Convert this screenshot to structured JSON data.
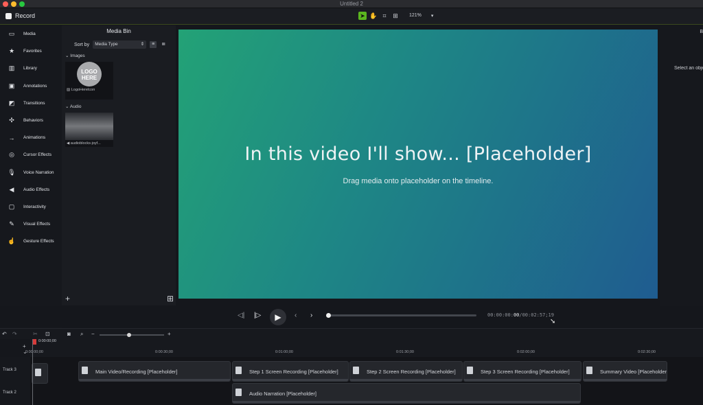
{
  "window": {
    "title": "Untitled 2",
    "record_label": "Record"
  },
  "toolbar": {
    "zoom": "121%",
    "zoom_arrow": "▾"
  },
  "sidebar": {
    "items": [
      {
        "label": "Media",
        "icon": "▭"
      },
      {
        "label": "Favorites",
        "icon": "★"
      },
      {
        "label": "Library",
        "icon": "▥"
      },
      {
        "label": "Annotations",
        "icon": "▣"
      },
      {
        "label": "Transitions",
        "icon": "◩"
      },
      {
        "label": "Behaviors",
        "icon": "✣"
      },
      {
        "label": "Animations",
        "icon": "→"
      },
      {
        "label": "Cursor Effects",
        "icon": "◎"
      },
      {
        "label": "Voice Narration",
        "icon": "🎙"
      },
      {
        "label": "Audio Effects",
        "icon": "◀"
      },
      {
        "label": "Interactivity",
        "icon": "▢"
      },
      {
        "label": "Visual Effects",
        "icon": "✎"
      },
      {
        "label": "Gesture Effects",
        "icon": "☝"
      }
    ]
  },
  "media_bin": {
    "title": "Media Bin",
    "sort_label": "Sort by",
    "sort_value": "Media Type",
    "images_section": "Images",
    "logo_text": "LOGO HERE",
    "image_file": "LogoHereIcon",
    "audio_section": "Audio",
    "audio_file": "audioblocks-joyf..."
  },
  "canvas": {
    "title": "In this video I'll show... [Placeholder]",
    "subtitle": "Drag media onto placeholder on the timeline."
  },
  "right_panel": {
    "tab_letter": "B",
    "text": "Select an object"
  },
  "playback": {
    "time_muted_prefix": "00:00:00:",
    "time_current": "00",
    "time_total": "/00:02:57;19",
    "progress": 0.0
  },
  "timeline": {
    "playhead_time": "0:00:00;00",
    "ticks": [
      "0:00:00;00",
      "0:00:30;00",
      "0:01:00;00",
      "0:01:30;00",
      "0:02:00;00",
      "0:02:30;00"
    ],
    "tracks": [
      {
        "name": "Track 3"
      },
      {
        "name": "Track 2"
      }
    ],
    "track3_clips": [
      "Main Video/Recording [Placeholder]",
      "Step 1 Screen Recording [Placeholder]",
      "Step 2 Screen Recording [Placeholder]",
      "Step 3 Screen Recording [Placeholder]",
      "Summary Video [Placeholder]"
    ],
    "track2_clips": [
      "Audio Narration [Placeholder]"
    ]
  },
  "colors": {
    "accent": "#5bb61f",
    "canvas_start": "#23a276",
    "canvas_end": "#1f5c90",
    "playhead": "#d63b3b"
  }
}
